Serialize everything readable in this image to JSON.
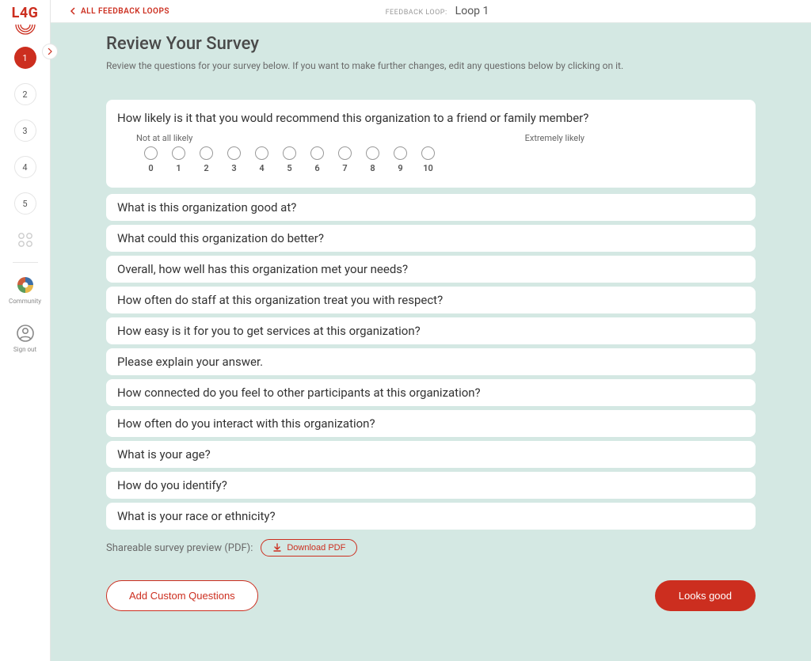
{
  "logo": "L4G",
  "sidebar": {
    "steps": [
      "1",
      "2",
      "3",
      "4",
      "5"
    ],
    "active_step": 0,
    "community_label": "Community",
    "signout_label": "Sign out"
  },
  "breadcrumb": {
    "back_label": "ALL FEEDBACK LOOPS",
    "section_label": "FEEDBACK LOOP:",
    "section_value": "Loop 1"
  },
  "page": {
    "title": "Review Your Survey",
    "subtitle": "Review the questions for your survey below. If you want to make further changes, edit any questions below by clicking on it."
  },
  "scale": {
    "left_label": "Not at all likely",
    "right_label": "Extremely likely",
    "values": [
      "0",
      "1",
      "2",
      "3",
      "4",
      "5",
      "6",
      "7",
      "8",
      "9",
      "10"
    ]
  },
  "questions": [
    "How likely is it that you would recommend this organization to a friend or family member?",
    "What is this organization good at?",
    "What could this organization do better?",
    "Overall, how well has this organization met your needs?",
    "How often do staff at this organization treat you with respect?",
    "How easy is it for you to get services at this organization?",
    "Please explain your answer.",
    "How connected do you feel to other participants at this organization?",
    "How often do you interact with this organization?",
    "What is your age?",
    "How do you identify?",
    "What is your race or ethnicity?"
  ],
  "pdf": {
    "label": "Shareable survey preview (PDF):",
    "button": "Download PDF"
  },
  "footer": {
    "add_questions": "Add Custom Questions",
    "looks_good": "Looks good"
  }
}
